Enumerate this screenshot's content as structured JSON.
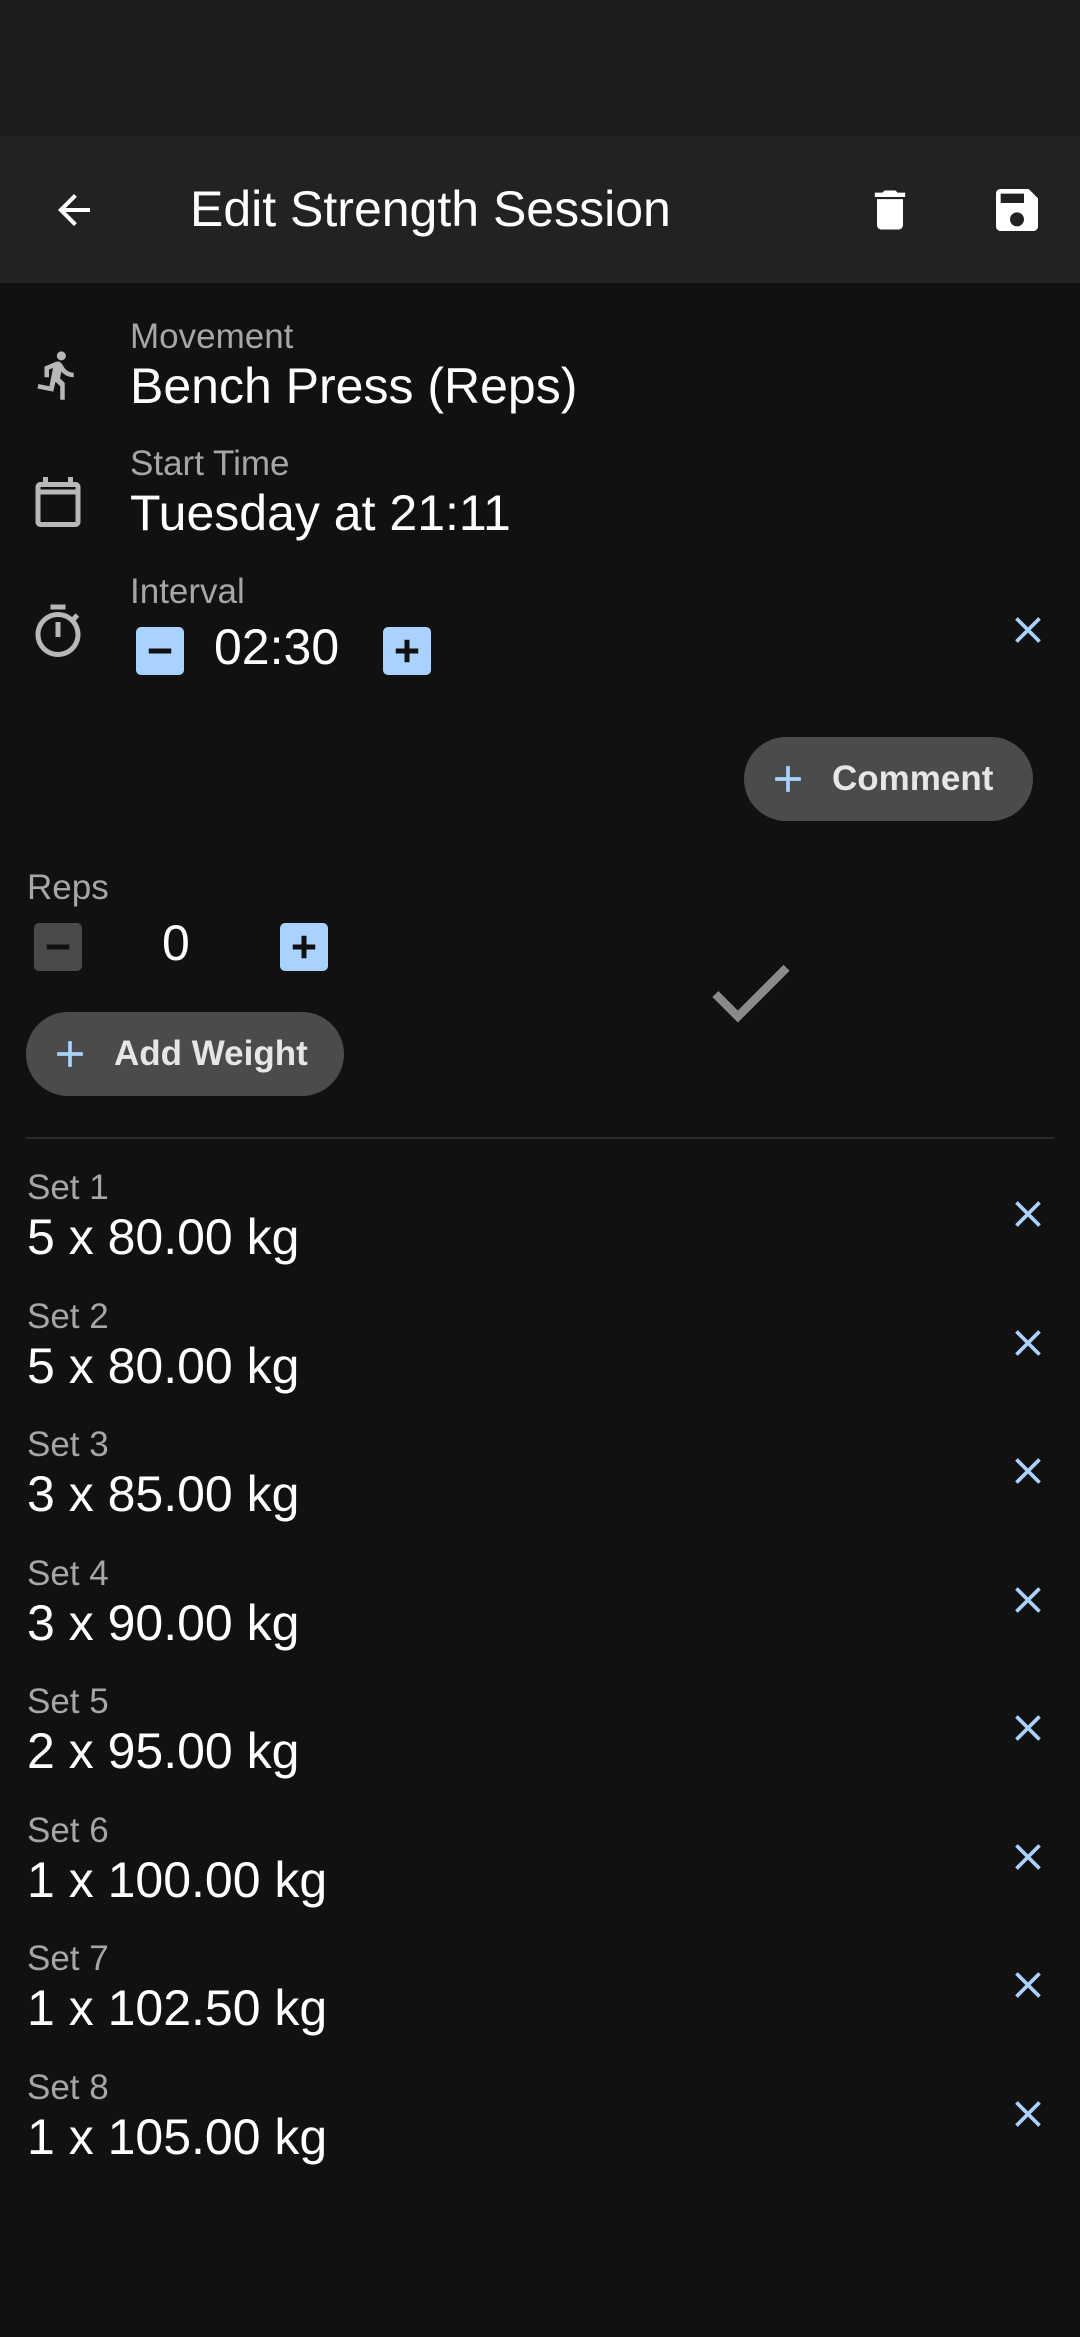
{
  "header": {
    "title": "Edit Strength Session"
  },
  "movement": {
    "label": "Movement",
    "value": "Bench Press (Reps)"
  },
  "start_time": {
    "label": "Start Time",
    "value": "Tuesday at 21:11"
  },
  "interval": {
    "label": "Interval",
    "value": "02:30"
  },
  "comment_button": {
    "label": "Comment"
  },
  "reps": {
    "label": "Reps",
    "value": "0"
  },
  "add_weight_button": {
    "label": "Add Weight"
  },
  "sets": [
    {
      "label": "Set 1",
      "value": "5 x 80.00 kg"
    },
    {
      "label": "Set 2",
      "value": "5 x 80.00 kg"
    },
    {
      "label": "Set 3",
      "value": "3 x 85.00 kg"
    },
    {
      "label": "Set 4",
      "value": "3 x 90.00 kg"
    },
    {
      "label": "Set 5",
      "value": "2 x 95.00 kg"
    },
    {
      "label": "Set 6",
      "value": "1 x 100.00 kg"
    },
    {
      "label": "Set 7",
      "value": "1 x 102.50 kg"
    },
    {
      "label": "Set 8",
      "value": "1 x 105.00 kg"
    }
  ],
  "icons": {
    "back": "arrow-back-icon",
    "delete": "trash-icon",
    "save": "floppy-disk-icon",
    "movement": "running-person-icon",
    "start_time": "calendar-icon",
    "interval": "timer-icon",
    "confirm": "checkmark-icon",
    "remove": "close-icon"
  },
  "colors": {
    "accent": "#a9d2ff",
    "background": "#111111",
    "app_bar": "#222222",
    "status_bar": "#1c1c1c",
    "pill": "#4b4b4b"
  }
}
